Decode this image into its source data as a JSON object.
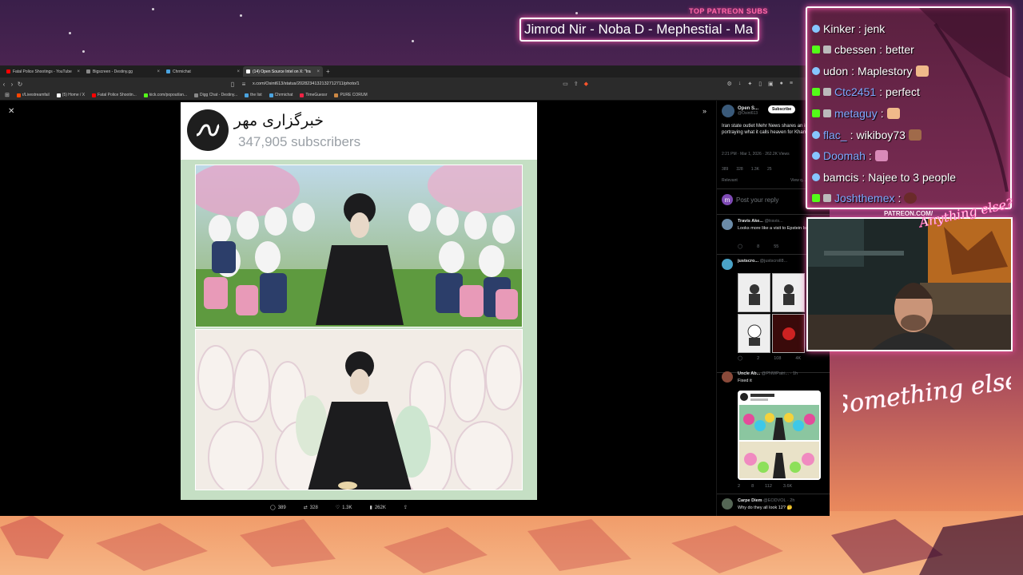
{
  "overlay": {
    "patreon_heading": "TOP PATREON SUBS",
    "patreon_names": "Jimrod Nir - Noba D - Mephestial - Ma",
    "patreon_url": "PATREON.COM/",
    "neon_sign": "Something else",
    "neon_small": "Anything else?"
  },
  "browser": {
    "tabs": [
      {
        "title": "Fatal Police Shootings - YouTube",
        "color": "#ff0000"
      },
      {
        "title": "Bigscreen - Destiny.gg",
        "color": "#888888"
      },
      {
        "title": "Chrmichat",
        "color": "#4aa3df"
      },
      {
        "title": "(14) Open Source Intel on X: \"Ira",
        "color": "#ffffff",
        "active": true
      }
    ],
    "url": "x.com/Osint613/status/2028234132132712711/photo/1",
    "bookmarks": [
      "r/Livestreamfail",
      "(5) Home / X",
      "Fatal Police Shootin...",
      "kick.com/popout/an...",
      "Digg Chat - Destiny...",
      "the list",
      "Chrmichat",
      "TimeGuessr",
      "PURE CORUM"
    ]
  },
  "media": {
    "channel_name": "خبرگزاری مهر",
    "subscribers": "347,905 subscribers",
    "actions": {
      "replies": "389",
      "reposts": "328",
      "likes": "1.3K",
      "views": "262K"
    }
  },
  "tweet": {
    "author_name": "Open S...",
    "author_handle": "@Osint613",
    "subscribe_label": "Subscribe",
    "text": "Iran state outlet Mehr News shares an image portraying what it calls heaven for Khamenei.",
    "meta": "2:21 PM · Mar 1, 2026 · 262.2K Views",
    "stats": [
      "389",
      "328",
      "1.3K",
      "25"
    ],
    "relevant": "Relevant",
    "view_quotes": "View q...",
    "reply_placeholder": "Post your reply",
    "reply_avatar_letter": "m",
    "replies": [
      {
        "name": "Travis Ake...",
        "handle": "@travis...",
        "text": "Looks more like a visit to Epstein Island.",
        "stats": [
          "8",
          "55"
        ],
        "color": "#6b8ba8"
      },
      {
        "name": "justscro...",
        "handle": "@justscroll8...",
        "text": "",
        "stats": [
          "2",
          "108",
          "4K"
        ],
        "color": "#4aa3c8"
      },
      {
        "name": "Uncle Ab...",
        "handle": "@PNWPatri... · 1h",
        "text": "Fixed it",
        "stats": [
          "2",
          "8",
          "112",
          "3.6K"
        ],
        "color": "#8a4a3a"
      },
      {
        "name": "Carpe Diem",
        "handle": "@EODVOL · 2h",
        "text": "Why do they all look 12? 🤔",
        "stats": [],
        "color": "#556655"
      }
    ]
  },
  "chat": [
    {
      "user": "Kinker",
      "msg": "jenk",
      "badge": "blue",
      "user_color": "#ffffff"
    },
    {
      "user": "cbessen",
      "msg": "better",
      "badge": "green",
      "user_color": "#ffffff"
    },
    {
      "user": "udon",
      "msg": "Maplestory",
      "badge": "blue",
      "user_color": "#ffffff"
    },
    {
      "user": "Ctc2451",
      "msg": "perfect",
      "badge": "green",
      "user_color": "#7fa8ff"
    },
    {
      "user": "metaguy",
      "msg": "",
      "badge": "blue",
      "user_color": "#7fa8ff"
    },
    {
      "user": "flac_",
      "msg": "wikiboy73",
      "badge": "blue",
      "user_color": "#7fa8ff"
    },
    {
      "user": "Doomah",
      "msg": "",
      "badge": "blue",
      "user_color": "#7fa8ff"
    },
    {
      "user": "bamcis",
      "msg": "Najee to 3 people",
      "badge": "blue",
      "user_color": "#ffffff"
    },
    {
      "user": "Joshthemex",
      "msg": "",
      "badge": "green",
      "user_color": "#7fa8ff"
    }
  ]
}
